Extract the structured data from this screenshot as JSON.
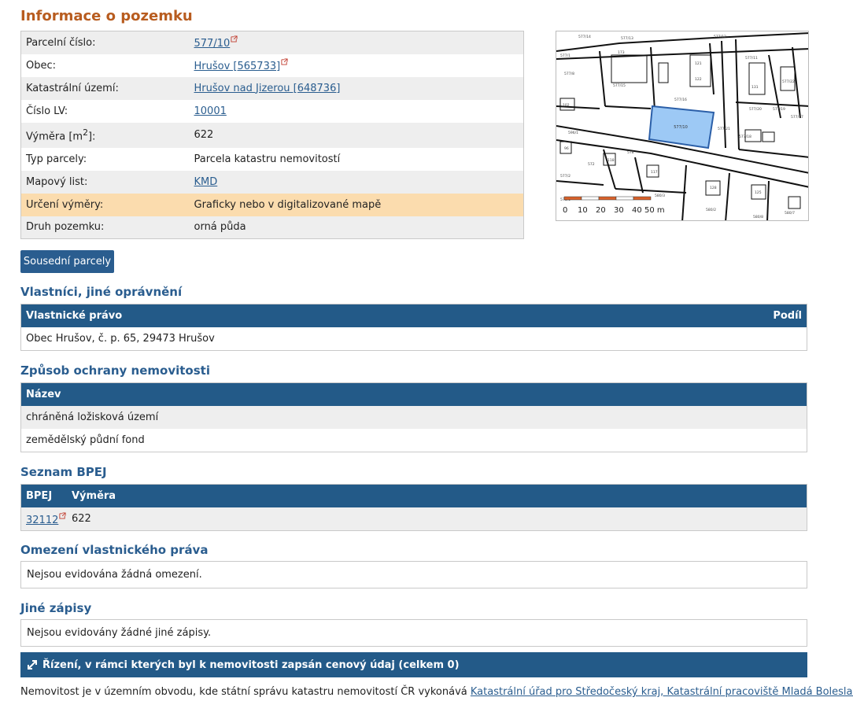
{
  "title": "Informace o pozemku",
  "info_rows": [
    {
      "label": "Parcelní číslo:",
      "value": "577/10"
    },
    {
      "label": "Obec:",
      "value": "Hrušov [565733]"
    },
    {
      "label": "Katastrální území:",
      "value": "Hrušov nad Jizerou [648736]"
    },
    {
      "label": "Číslo LV:",
      "value": "10001"
    },
    {
      "label": "Výměra [m",
      "label_sup": "2",
      "label_after": "]:",
      "value": "622"
    },
    {
      "label": "Typ parcely:",
      "value": "Parcela katastru nemovitostí"
    },
    {
      "label": "Mapový list:",
      "value": "KMD"
    },
    {
      "label": "Určení výměry:",
      "value": "Graficky nebo v digitalizované mapě"
    },
    {
      "label": "Druh pozemku:",
      "value": "orná půda"
    }
  ],
  "map": {
    "selected_parcel_label": "577/10",
    "scale_labels": [
      "0",
      "10",
      "20",
      "30",
      "40",
      "50 m"
    ],
    "parcel_labels": [
      "577/14",
      "577/13",
      "577/1",
      "173",
      "121",
      "577/12",
      "577/8",
      "122",
      "577/11",
      "102",
      "577/10",
      "577/15",
      "577/16",
      "131",
      "577/22",
      "577/20",
      "577/19",
      "577/17",
      "577/18",
      "577/21",
      "96",
      "596/1",
      "577/2",
      "572",
      "578",
      "578/1",
      "118",
      "117",
      "128",
      "125",
      "580/3",
      "580/2",
      "580/8",
      "580/7",
      "577/3",
      "115",
      "577/4"
    ],
    "colors": {
      "selected_fill": "#9dc9f5",
      "selected_stroke": "#2b5fa8",
      "scale_orange": "#d9622b"
    }
  },
  "buttons": {
    "sousedni": "Sousední parcely"
  },
  "sections": {
    "vlastnici": {
      "title": "Vlastníci, jiné oprávnění",
      "col_left": "Vlastnické právo",
      "col_right": "Podíl",
      "rows": [
        "Obec Hrušov, č. p. 65, 29473 Hrušov"
      ]
    },
    "ochrana": {
      "title": "Způsob ochrany nemovitosti",
      "col": "Název",
      "rows": [
        "chráněná ložisková území",
        "zemědělský půdní fond"
      ]
    },
    "bpej": {
      "title": "Seznam BPEJ",
      "col_bpej": "BPEJ",
      "col_vymera": "Výměra",
      "rows": [
        {
          "bpej": "32112",
          "vymera": "622"
        }
      ]
    },
    "omezeni": {
      "title": "Omezení vlastnického práva",
      "text": "Nejsou evidována žádná omezení."
    },
    "jine": {
      "title": "Jiné zápisy",
      "text": "Nejsou evidovány žádné jiné zápisy."
    }
  },
  "rizeni": {
    "label": "Řízení, v rámci kterých byl k nemovitosti zapsán cenový údaj (celkem 0)",
    "icon": "expand-arrows-icon"
  },
  "footer": {
    "text": "Nemovitost je v územním obvodu, kde státní správu katastru nemovitostí ČR vykonává ",
    "link": "Katastrální úřad pro Středočeský kraj, Katastrální pracoviště Mladá Boleslav"
  },
  "colors": {
    "accent_title": "#b85c1f",
    "section_blue": "#2a5d8f",
    "header_blue": "#235a88",
    "highlight_row": "#fbdcae",
    "external_link_icon": "#c0392b"
  }
}
